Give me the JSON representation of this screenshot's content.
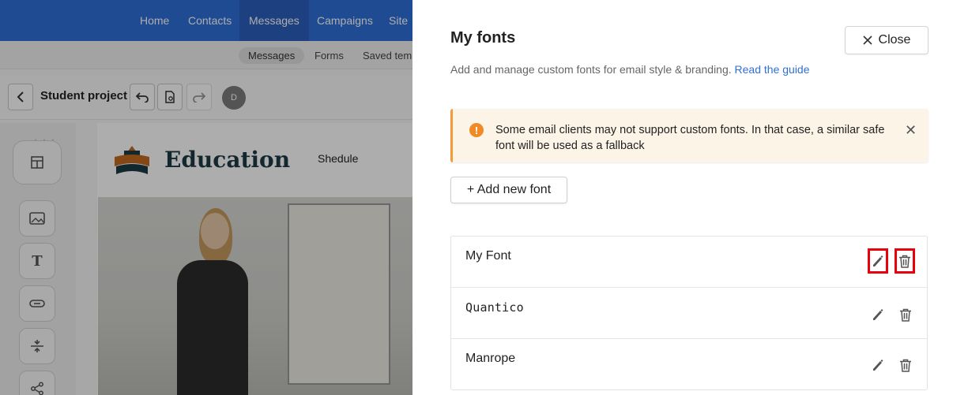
{
  "background": {
    "nav": [
      {
        "label": "Home"
      },
      {
        "label": "Contacts"
      },
      {
        "label": "Messages"
      },
      {
        "label": "Campaigns"
      },
      {
        "label": "Site"
      }
    ],
    "active_nav": "Messages",
    "subnav": [
      {
        "label": "Messages"
      },
      {
        "label": "Forms"
      },
      {
        "label": "Saved temp"
      }
    ],
    "project_title": "Student project",
    "avatar_initial": "D",
    "edu_title": "Education",
    "edu_link": "Shedule"
  },
  "drawer": {
    "title": "My fonts",
    "close_label": "Close",
    "subtitle_text": "Add and manage custom fonts for email style & branding.",
    "guide_link": "Read the guide",
    "alert_text": "Some email clients may not support custom fonts. In that case, a similar safe font will be used as a fallback",
    "add_label": "+ Add new font",
    "fonts": [
      {
        "name": "My Font",
        "highlighted": true
      },
      {
        "name": "Quantico",
        "highlighted": false
      },
      {
        "name": "Manrope",
        "highlighted": false
      }
    ]
  },
  "colors": {
    "accent_blue": "#2f6fd8",
    "warning_orange": "#ef8a24",
    "highlight_red": "#e8000a"
  }
}
